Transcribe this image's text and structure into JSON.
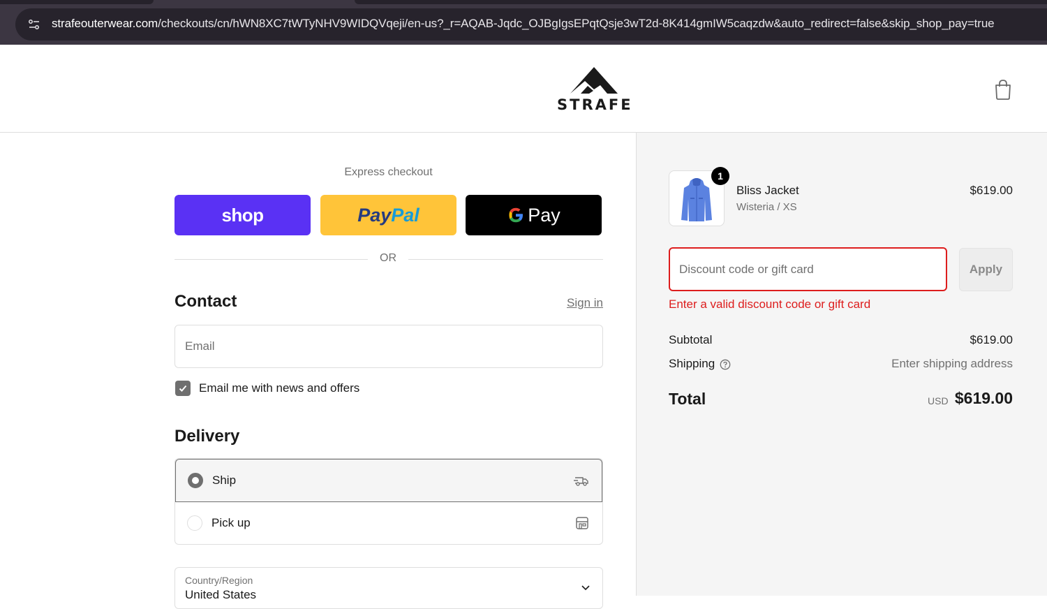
{
  "browser": {
    "url_domain": "strafeouterwear.com",
    "url_path": "/checkouts/cn/hWN8XC7tWTyNHV9WIDQVqeji/en-us?_r=AQAB-Jqdc_OJBgIgsEPqtQsje3wT2d-8K414gmIW5caqzdw&auto_redirect=false&skip_shop_pay=true"
  },
  "header": {
    "brand": "STRAFE",
    "icons": {
      "logo": "mountain-logo-icon",
      "cart": "shopping-bag-icon"
    }
  },
  "express": {
    "label": "Express checkout",
    "shop_label": "shop",
    "paypal_pay": "Pay",
    "paypal_pal": "Pal",
    "gpay_label": "Pay",
    "or_label": "OR"
  },
  "contact": {
    "title": "Contact",
    "signin": "Sign in",
    "email_placeholder": "Email",
    "newsletter_label": "Email me with news and offers",
    "newsletter_checked": true
  },
  "delivery": {
    "title": "Delivery",
    "options": [
      {
        "label": "Ship",
        "selected": true,
        "icon": "truck-icon"
      },
      {
        "label": "Pick up",
        "selected": false,
        "icon": "store-icon"
      }
    ],
    "country_label": "Country/Region",
    "country_value": "United States"
  },
  "summary": {
    "item": {
      "name": "Bliss Jacket",
      "variant": "Wisteria / XS",
      "price": "$619.00",
      "quantity": "1"
    },
    "discount_placeholder": "Discount code or gift card",
    "apply_label": "Apply",
    "discount_error": "Enter a valid discount code or gift card",
    "subtotal_label": "Subtotal",
    "subtotal_value": "$619.00",
    "shipping_label": "Shipping",
    "shipping_value": "Enter shipping address",
    "total_label": "Total",
    "currency": "USD",
    "total_value": "$619.00"
  },
  "colors": {
    "shop_pay": "#5a31f4",
    "paypal": "#ffc439",
    "gpay": "#000000",
    "error": "#dd1d1d"
  }
}
